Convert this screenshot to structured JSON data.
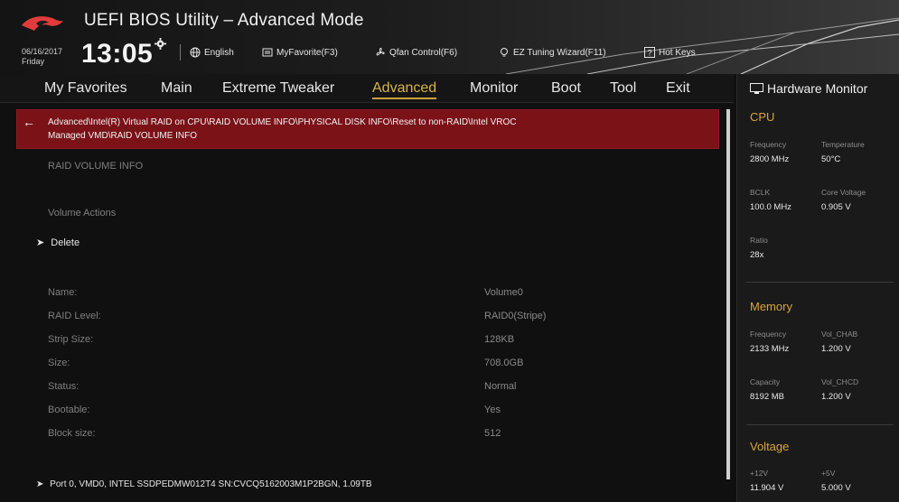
{
  "header": {
    "title": "UEFI BIOS Utility – Advanced Mode",
    "date": "06/16/2017",
    "day": "Friday",
    "time": "13:05",
    "toolbar": [
      {
        "label": "English",
        "icon": "globe-icon"
      },
      {
        "label": "MyFavorite(F3)",
        "icon": "favorite-list-icon"
      },
      {
        "label": "Qfan Control(F6)",
        "icon": "fan-icon"
      },
      {
        "label": "EZ Tuning Wizard(F11)",
        "icon": "bulb-icon"
      },
      {
        "label": "Hot Keys",
        "icon": "question-box-icon"
      }
    ]
  },
  "nav": {
    "items": [
      "My Favorites",
      "Main",
      "Extreme Tweaker",
      "Advanced",
      "Monitor",
      "Boot",
      "Tool",
      "Exit"
    ],
    "active": "Advanced"
  },
  "breadcrumb": {
    "line1": "Advanced\\Intel(R) Virtual RAID on CPU\\RAID VOLUME INFO\\PHYSICAL DISK INFO\\Reset to non-RAID\\Intel VROC",
    "line2": "Managed VMD\\RAID VOLUME INFO"
  },
  "main": {
    "section_title": "RAID VOLUME INFO",
    "actions_label": "Volume Actions",
    "delete_label": "Delete",
    "fields": [
      {
        "label": "Name:",
        "value": "Volume0"
      },
      {
        "label": "RAID Level:",
        "value": "RAID0(Stripe)"
      },
      {
        "label": "Strip Size:",
        "value": "128KB"
      },
      {
        "label": "Size:",
        "value": "708.0GB"
      },
      {
        "label": "Status:",
        "value": "Normal"
      },
      {
        "label": "Bootable:",
        "value": "Yes"
      },
      {
        "label": "Block size:",
        "value": "512"
      }
    ],
    "port_item": "Port 0, VMD0, INTEL SSDPEDMW012T4 SN:CVCQ5162003M1P2BGN, 1.09TB"
  },
  "hw_monitor": {
    "title": "Hardware Monitor",
    "cpu": {
      "title": "CPU",
      "frequency_label": "Frequency",
      "frequency": "2800 MHz",
      "temperature_label": "Temperature",
      "temperature": "50°C",
      "bclk_label": "BCLK",
      "bclk": "100.0 MHz",
      "core_voltage_label": "Core Voltage",
      "core_voltage": "0.905 V",
      "ratio_label": "Ratio",
      "ratio": "28x"
    },
    "memory": {
      "title": "Memory",
      "frequency_label": "Frequency",
      "frequency": "2133 MHz",
      "vol_chab_label": "Vol_CHAB",
      "vol_chab": "1.200 V",
      "capacity_label": "Capacity",
      "capacity": "8192 MB",
      "vol_chcd_label": "Vol_CHCD",
      "vol_chcd": "1.200 V"
    },
    "voltage": {
      "title": "Voltage",
      "v12_label": "+12V",
      "v12": "11.904 V",
      "v5_label": "+5V",
      "v5": "5.000 V"
    }
  },
  "colors": {
    "accent_gold": "#c9a33a",
    "breadcrumb_red": "#7a1218",
    "background": "#101010"
  }
}
